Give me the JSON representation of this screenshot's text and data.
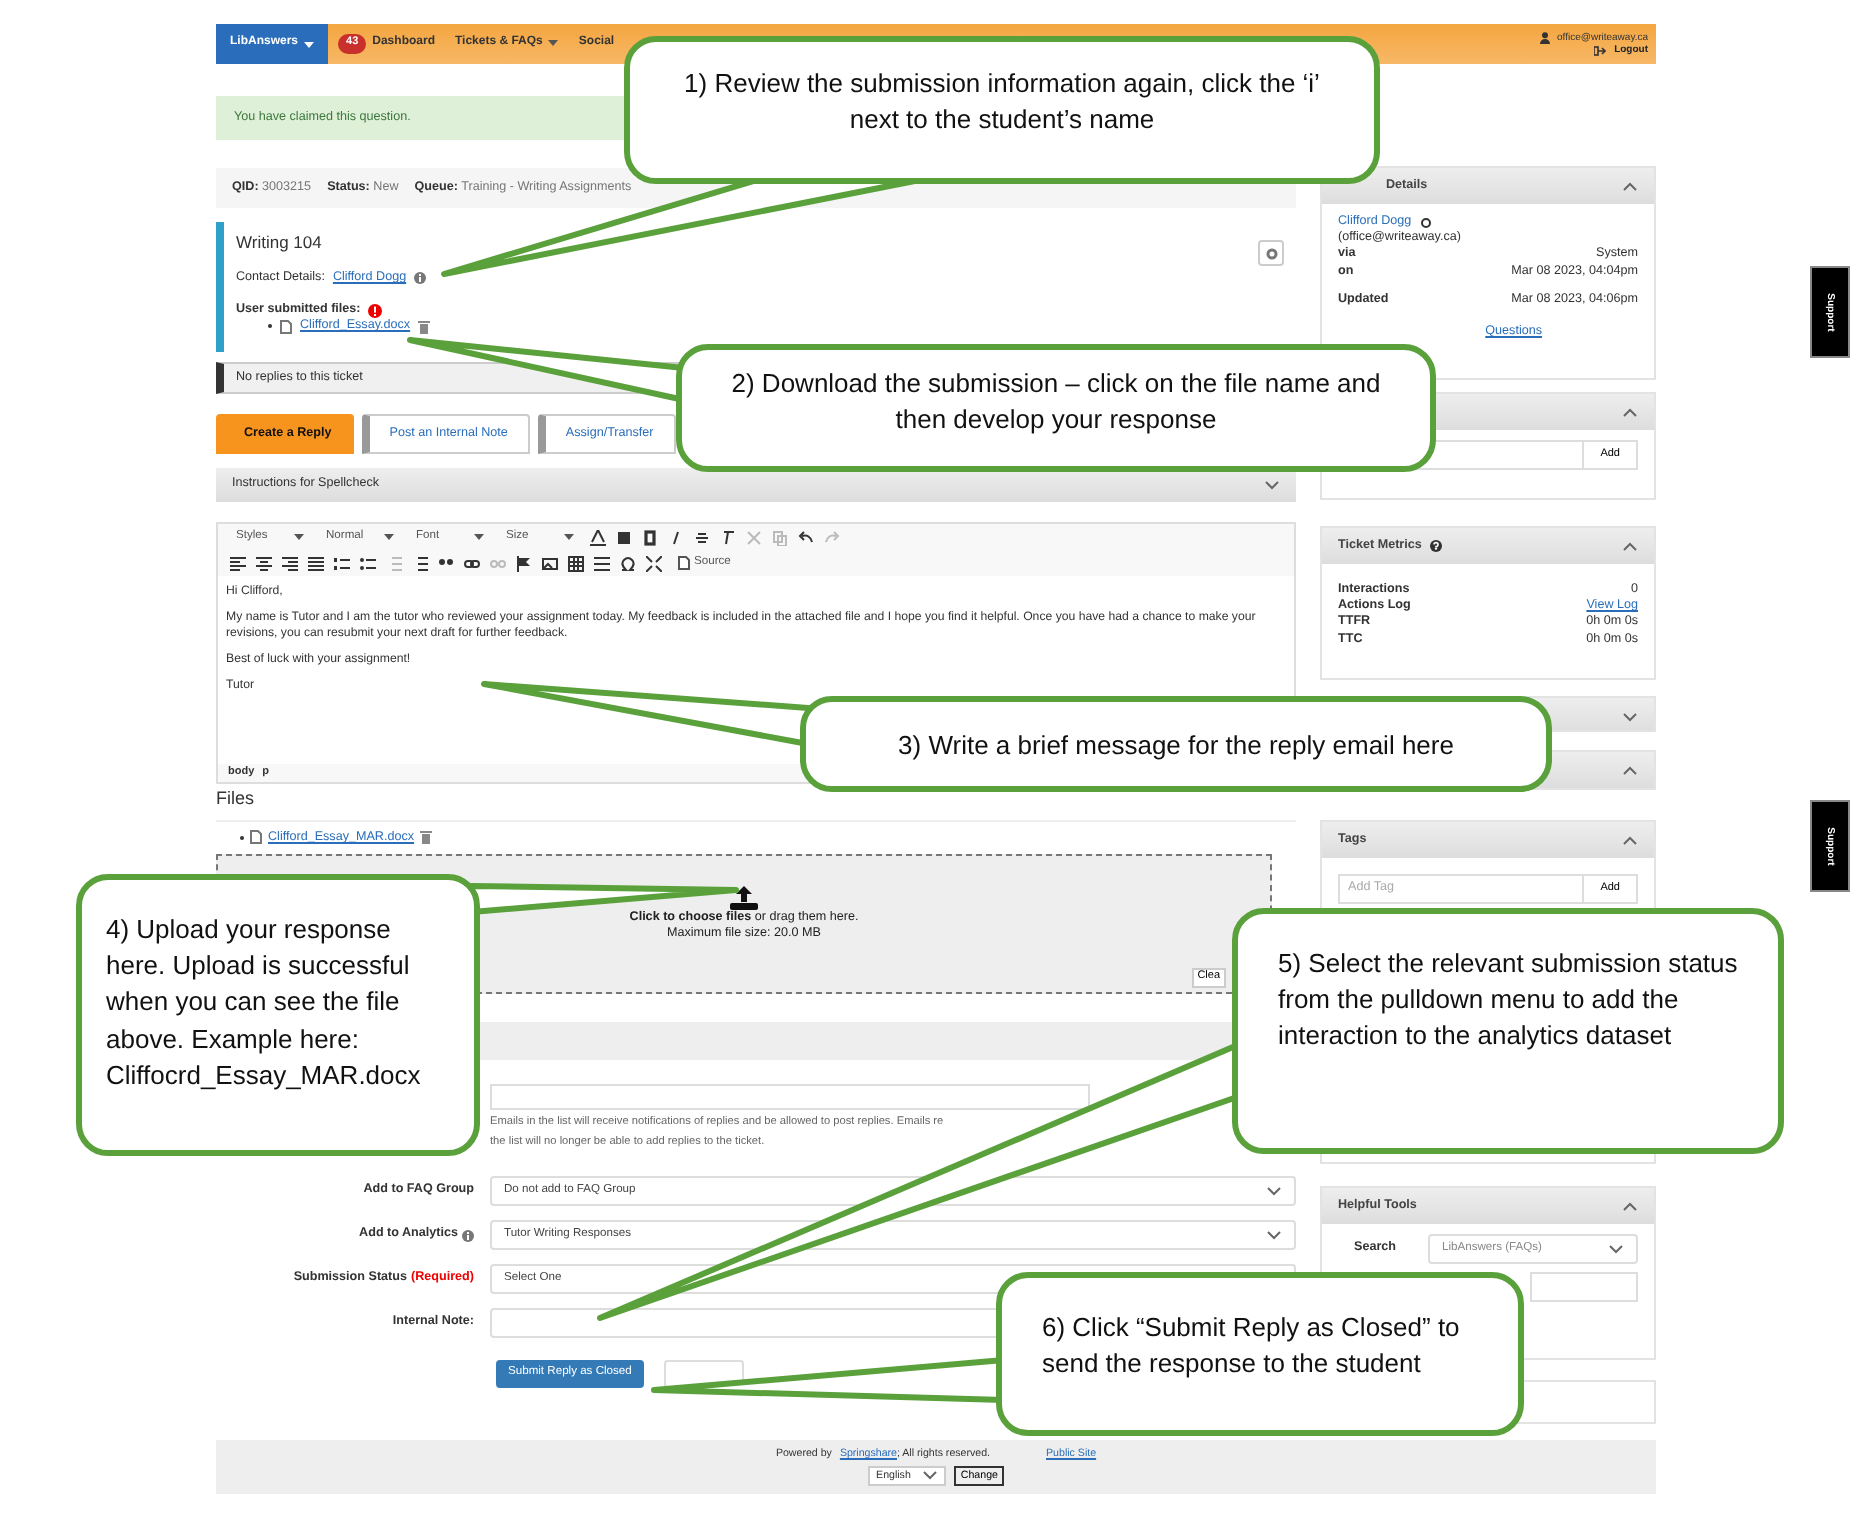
{
  "navbar": {
    "brand": "LibAnswers",
    "items": [
      {
        "label": "Dashboard",
        "badge": "43",
        "dropdown": false
      },
      {
        "label": "Tickets & FAQs",
        "dropdown": true
      },
      {
        "label": "Social",
        "dropdown": false
      }
    ],
    "user": "office@writeaway.ca",
    "logout": "Logout"
  },
  "alert": "You have claimed this question.",
  "meta": [
    {
      "label": "QID:",
      "value": "3003215"
    },
    {
      "label": "Status:",
      "value": "New"
    },
    {
      "label": "Queue:",
      "value": "Training - Writing Assignments"
    }
  ],
  "question": {
    "title": "Writing 104",
    "contact_label": "Contact Details:",
    "contact_name": "Clifford Dogg",
    "files_label": "User submitted files:",
    "files": [
      "Clifford_Essay.docx"
    ]
  },
  "replies_note": "No replies to this ticket",
  "tabs": [
    {
      "label": "Create a Reply",
      "selected": true
    },
    {
      "label": "Post an Internal Note",
      "selected": false
    },
    {
      "label": "Assign/Transfer",
      "selected": false
    }
  ],
  "spellcheck": "Instructions for Spellcheck",
  "editor": {
    "dropdowns": [
      "Styles",
      "Normal",
      "Font",
      "Size"
    ],
    "source": "Source",
    "body": [
      "Hi Clifford,",
      "My name is Tutor and I am the tutor who reviewed your assignment today. My feedback is included in the attached file and I hope you find it helpful. Once you have had a chance to make your revisions, you can resubmit your next draft for further feedback.",
      "Best of luck with your assignment!",
      "Tutor"
    ],
    "path": [
      "body",
      "p"
    ]
  },
  "files": {
    "heading": "Files",
    "items": [
      "Clifford_Essay_MAR.docx"
    ]
  },
  "dropzone": {
    "text": "**Click to choose files** or drag them here.",
    "limit": "Maximum file size: 20.0 MB",
    "clear": "Clea"
  },
  "cc_help": [
    "Emails in the list will receive notifications of replies and be allowed to post replies. Emails re",
    "the list will no longer be able to add replies to the ticket."
  ],
  "form": [
    {
      "label": "Add to FAQ Group",
      "kind": "select",
      "value": "Do not add to FAQ Group"
    },
    {
      "label": "Add to Analytics",
      "info": true,
      "kind": "select",
      "value": "Tutor Writing Responses"
    },
    {
      "label": "Submission Status",
      "required": "(Required)",
      "kind": "select",
      "value": "Select One"
    },
    {
      "label": "Internal Note:",
      "kind": "input"
    }
  ],
  "submit": "Submit Reply as Closed",
  "footer": {
    "powered": "Powered by",
    "link": "Springshare",
    "rights": "; All rights reserved.",
    "public_site": "Public Site",
    "language": "English",
    "change": "Change"
  },
  "sidebar": [
    {
      "kind": "details",
      "title": "Details",
      "name": "Clifford Dogg",
      "email": "(office@writeaway.ca)",
      "rows": [
        {
          "label": "via",
          "value": "System"
        },
        {
          "label": "on",
          "value": "Mar 08 2023, 04:04pm"
        },
        {
          "label": "Updated",
          "value": "Mar 08 2023, 04:06pm"
        }
      ],
      "link": "Questions"
    },
    {
      "kind": "add",
      "button": "Add"
    },
    {
      "kind": "metrics",
      "title": "Ticket Metrics",
      "rows": [
        {
          "label": "Interactions",
          "value": "0",
          "link": false
        },
        {
          "label": "Actions Log",
          "value": "View Log",
          "link": true
        },
        {
          "label": "TTFR",
          "value": "0h 0m 0s",
          "link": false
        },
        {
          "label": "TTC",
          "value": "0h 0m 0s",
          "link": false
        }
      ]
    },
    {
      "kind": "collapsed",
      "expanded": false
    },
    {
      "kind": "collapsed",
      "expanded": true
    },
    {
      "kind": "tags",
      "title": "Tags",
      "placeholder": "Add Tag",
      "button": "Add"
    },
    {
      "kind": "hidden"
    },
    {
      "kind": "tools",
      "title": "Helpful Tools",
      "label": "Search",
      "select": "LibAnswers (FAQs)"
    },
    {
      "kind": "hidden"
    }
  ],
  "support_tabs": [
    "Support",
    "Support"
  ],
  "callouts": [
    "1) Review the submission information again, click the ‘i’ next to the student’s name",
    "2) Download the submission – click on the file name and then develop your response",
    "3) Write a brief message for the reply email here",
    "4) Upload your response here. Upload is successful when you can see the file above. Example here: Cliffocrd_Essay_MAR.docx",
    "5) Select the relevant submission status from the pulldown menu to add the interaction to the analytics dataset",
    "6) Click “Submit Reply as Closed” to send the response to the student"
  ]
}
